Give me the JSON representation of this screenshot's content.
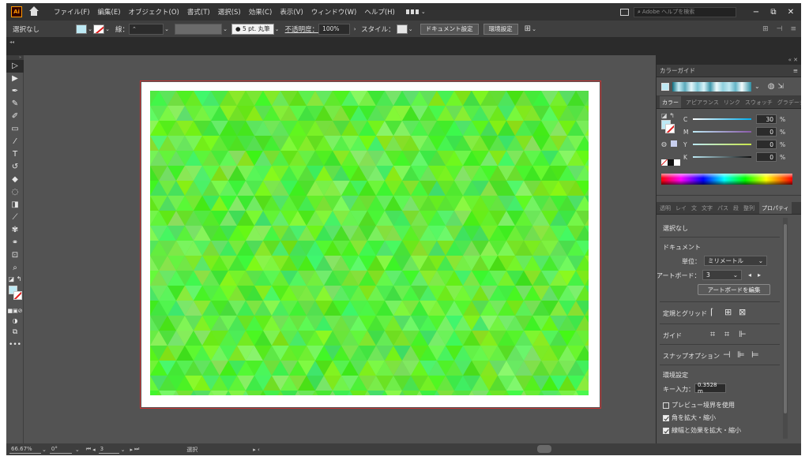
{
  "menubar": {
    "app_logo": "Ai",
    "items": [
      "ファイル(F)",
      "編集(E)",
      "オブジェクト(O)",
      "書式(T)",
      "選択(S)",
      "効果(C)",
      "表示(V)",
      "ウィンドウ(W)",
      "ヘルプ(H)"
    ],
    "help_search_placeholder": "Adobe ヘルプを検索",
    "window_controls": [
      "−",
      "⧉",
      "✕"
    ]
  },
  "controlbar": {
    "selection": "選択なし",
    "stroke_label": "線：",
    "stroke_style": "● 5 pt. 丸筆",
    "opacity_label": "不透明度：",
    "opacity_value": "100%",
    "style_label": "スタイル：",
    "doc_settings_button": "ドキュメント設定",
    "preferences_button": "環境設定"
  },
  "statusbar": {
    "zoom": "66.67%",
    "rotation": "0°",
    "artboard_number": "3",
    "tool_name": "選択"
  },
  "color_guide_panel": {
    "title": "カラーガイド"
  },
  "color_panel": {
    "tabs": [
      "カラー",
      "アピアランス",
      "リンク",
      "スウォッチ",
      "グラデーション"
    ],
    "cmyk": [
      {
        "label": "C",
        "value": "30",
        "unit": "%"
      },
      {
        "label": "M",
        "value": "0",
        "unit": "%"
      },
      {
        "label": "Y",
        "value": "0",
        "unit": "%"
      },
      {
        "label": "K",
        "value": "0",
        "unit": "%"
      }
    ]
  },
  "properties_panel": {
    "tabs": [
      "透明",
      "レイ",
      "文",
      "文字",
      "パス",
      "段",
      "整列",
      "プロパティ"
    ],
    "selection": "選択なし",
    "document_heading": "ドキュメント",
    "units_label": "単位：",
    "units_value": "ミリメートル",
    "artboard_label": "アートボード：",
    "artboard_value": "3",
    "edit_artboard_button": "アートボードを編集",
    "rulers_grid_label": "定規とグリッド",
    "guides_label": "ガイド",
    "snap_label": "スナップオプション",
    "preferences_heading": "環境設定",
    "key_increment_label": "キー入力：",
    "key_increment_value": "0.3528 m",
    "preview_bounds": "プレビュー境界を使用",
    "scale_corners": "角を拡大・縮小",
    "scale_strokes": "線幅と効果を拡大・縮小"
  },
  "colors": {
    "fill": "#bde9f4",
    "stroke_none": "#e21d1d",
    "pattern_base": "#55e632",
    "artboard_border": "#c83232"
  }
}
